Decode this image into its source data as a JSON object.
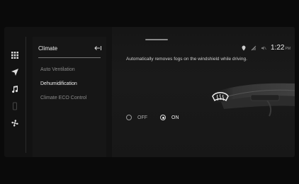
{
  "panel": {
    "title": "Climate",
    "menu": [
      {
        "label": "Auto Ventilation"
      },
      {
        "label": "Dehumidification"
      },
      {
        "label": "Climate ECO Control"
      }
    ]
  },
  "status": {
    "time": "1:22",
    "ampm": "PM"
  },
  "content": {
    "description": "Automatically removes fogs on the windshield while driving.",
    "options": [
      {
        "label": "OFF",
        "selected": false
      },
      {
        "label": "ON",
        "selected": true
      }
    ]
  },
  "icons": {
    "dock": [
      "grid-icon",
      "navigation-icon",
      "music-note-icon",
      "phone-icon",
      "fan-icon"
    ],
    "back": "back-arrow-icon",
    "status": [
      "location-icon",
      "signal-icon",
      "mute-icon"
    ]
  },
  "colors": {
    "background": "#121212",
    "accent": "#e8e8e8"
  }
}
